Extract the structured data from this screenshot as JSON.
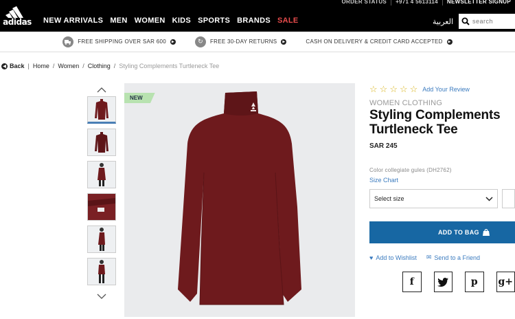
{
  "utility": {
    "order_status": "ORDER STATUS",
    "phone": "+971 4 5613114",
    "newsletter": "NEWSLETTER SIGNUP"
  },
  "brand": {
    "logo_text": "adidas"
  },
  "nav": {
    "items": [
      "NEW ARRIVALS",
      "MEN",
      "WOMEN",
      "KIDS",
      "SPORTS",
      "BRANDS",
      "SALE"
    ],
    "arabic": "العربية"
  },
  "search": {
    "placeholder": "search"
  },
  "promo": {
    "shipping": "FREE SHIPPING OVER SAR 600",
    "returns": "FREE 30-DAY RETURNS",
    "cod": "CASH ON DELIVERY & CREDIT CARD ACCEPTED"
  },
  "breadcrumb": {
    "back": "Back",
    "items": [
      "Home",
      "Women",
      "Clothing"
    ],
    "current": "Styling Complements Turtleneck Tee"
  },
  "product": {
    "badge": "NEW",
    "review_link": "Add Your Review",
    "category": "WOMEN CLOTHING",
    "title_line1": "Styling Complements",
    "title_line2": "Turtleneck Tee",
    "price": "SAR 245",
    "color": "Color collegiate gules (DH2762)",
    "size_chart": "Size Chart",
    "size_select": "Select size",
    "add_to_bag": "ADD TO BAG",
    "wishlist": "Add to Wishlist",
    "send_friend": "Send to a Friend",
    "rating": 0,
    "rating_max": 5
  },
  "colors": {
    "garment": "#6e1a1d",
    "accent": "#1767a3",
    "link": "#3b7bbf",
    "star": "#d8b31a",
    "sale": "#e84c4c"
  },
  "social": {
    "facebook": "f",
    "twitter": "twitter-icon",
    "pinterest": "p",
    "googleplus": "g+"
  }
}
